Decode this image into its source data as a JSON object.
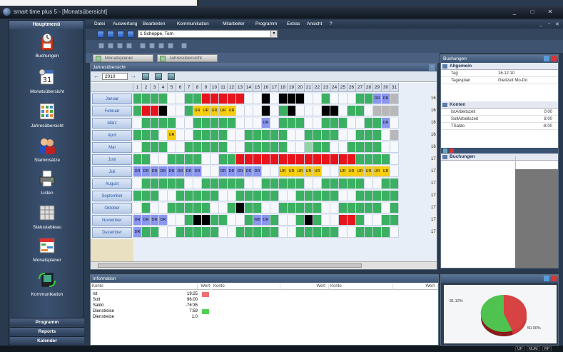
{
  "window": {
    "title": "smart time plus 5 - [Monatsübersicht]",
    "buttons": [
      "_",
      "□",
      "✕"
    ]
  },
  "leftnav": {
    "header": "Hauptmenü",
    "items": [
      {
        "label": "Buchungen",
        "icon": "time-clock-icon"
      },
      {
        "label": "Monatsübersicht",
        "icon": "calendar-31-icon"
      },
      {
        "label": "Jahresübersicht",
        "icon": "year-calendar-icon"
      },
      {
        "label": "Stammsätze",
        "icon": "users-icon"
      },
      {
        "label": "Listen",
        "icon": "printer-icon"
      },
      {
        "label": "Statustableau",
        "icon": "status-board-icon"
      },
      {
        "label": "Monatsplaner",
        "icon": "month-planner-icon"
      },
      {
        "label": "Kommunikation",
        "icon": "communication-icon"
      }
    ],
    "bottom": [
      "Programm",
      "Reports",
      "Kalender"
    ]
  },
  "menubar": [
    "Datei",
    "Auswertung",
    "Bearbeiten",
    "Kommunikation",
    "Mitarbeiter",
    "Programm",
    "Extras",
    "Ansicht",
    "?"
  ],
  "employee": {
    "selected": "1 Schoppe, Tom"
  },
  "tabs": [
    "Monatsplaner",
    "Jahresübersicht"
  ],
  "jahres": {
    "title": "Jahresübersicht",
    "year": "2010",
    "days": [
      "1",
      "2",
      "3",
      "4",
      "5",
      "6",
      "7",
      "8",
      "9",
      "10",
      "11",
      "12",
      "13",
      "14",
      "15",
      "16",
      "17",
      "18",
      "19",
      "20",
      "21",
      "22",
      "23",
      "24",
      "25",
      "26",
      "27",
      "28",
      "29",
      "30",
      "31"
    ],
    "side_values": [
      "16",
      "16",
      "16",
      "16",
      "16",
      "17",
      "17",
      "17",
      "17",
      "17",
      "17",
      "17"
    ],
    "months": [
      {
        "name": "Januar",
        "cells": "ggggwwggrrrrrwwkwkkkwwgwwwggbbs"
      },
      {
        "name": "Februar",
        "cells": "grrkwwgyyyyywwwkwgkwwwkkwggwsss"
      },
      {
        "name": "März",
        "cells": "wggggwwgggggwwwbwgggwwgggwwggbw"
      },
      {
        "name": "April",
        "cells": "gggwywwggggwwgggggwwggggwwgggws"
      },
      {
        "name": "Mai",
        "cells": "wgggwwgggggwwgggggwwlggwwggggww"
      },
      {
        "name": "Juni",
        "cells": "ggwwggggwwggrrrrrrrrrrrrrrggggw"
      },
      {
        "name": "Juli",
        "cells": "bbbbbbbbwwbbbbbwwyyyyywwyyyyyyw"
      },
      {
        "name": "August",
        "cells": "wgggggwwgggggwwgggggwwgggggwwgg"
      },
      {
        "name": "September",
        "cells": "gggwwgggggwwgggggwwgggggwwggggg"
      },
      {
        "name": "Oktober",
        "cells": "wgwwgggggwwgkggwwgggggwwgggggwg"
      },
      {
        "name": "November",
        "cells": "bbbbwwgkkggwwgbbgwwgkgwwrrgwwgg"
      },
      {
        "name": "Dezember",
        "cells": "bggwwgggggwwgggggwwgggggwwggggw"
      }
    ],
    "cell_text": {
      "r": "",
      "b": "DR",
      "y": "UR"
    },
    "special_text": {
      "November-15": "WB"
    }
  },
  "buchungen": {
    "title": "Buchungen",
    "allgemein_label": "Allgemein",
    "allgemein": [
      {
        "key": "Tag",
        "value": "16.12.10"
      },
      {
        "key": "Tagesplan",
        "value": "Gleitzeit Mo-Do"
      }
    ],
    "konten_label": "Konten",
    "konten": [
      {
        "key": "IstArbeitszeit",
        "value": "0:00"
      },
      {
        "key": "SollArbeitszeit",
        "value": "8:00"
      },
      {
        "key": "TSaldo",
        "value": "-8:00"
      }
    ],
    "buchungen_label": "Buchungen"
  },
  "information": {
    "title": "Information",
    "headers": [
      "Konto",
      "Wert",
      "Konto",
      "Wert",
      "Konto",
      "Wert"
    ],
    "rows": [
      {
        "konto": "Ist",
        "wert": "19:25",
        "mark": "#f07070"
      },
      {
        "konto": "Soll",
        "wert": "96:00",
        "mark": ""
      },
      {
        "konto": "Saldo",
        "wert": "-76:35",
        "mark": ""
      },
      {
        "konto": "Dienstreise",
        "wert": "7:59",
        "mark": "#50d050"
      },
      {
        "konto": "Dienstreise",
        "wert": "1.0",
        "mark": ""
      }
    ]
  },
  "pie": {
    "left_label": "81.12%",
    "right_label": "50.00%"
  },
  "status": [
    "UF",
    "NUM",
    "RF"
  ],
  "colors": {
    "green": "#3cb062",
    "red": "#e8141c",
    "yellow": "#f4cc10",
    "blue": "#8a96f0"
  }
}
